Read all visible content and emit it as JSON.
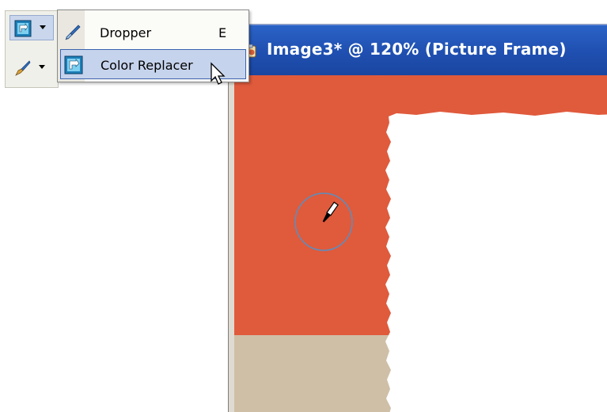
{
  "window": {
    "title": "Image3* @ 120% (Picture Frame)"
  },
  "toolbar": {
    "active_tool": "color-replacer-icon",
    "second_tool": "brush-icon"
  },
  "menu": {
    "items": [
      {
        "label": "Dropper",
        "shortcut": "E",
        "icon": "dropper-icon"
      },
      {
        "label": "Color Replacer",
        "shortcut": "",
        "icon": "color-replacer-icon"
      }
    ],
    "highlighted_index": 1
  },
  "canvas": {
    "frame_color": "#e05a3c",
    "lower_band_color": "#cfbfa6",
    "inner_color": "#ffffff",
    "brush_cursor_color": "#5a8fc0"
  },
  "colors": {
    "title_bar": "#1f4fb0",
    "menu_highlight": "#c6d3ec",
    "menu_highlight_border": "#3c64ad"
  }
}
